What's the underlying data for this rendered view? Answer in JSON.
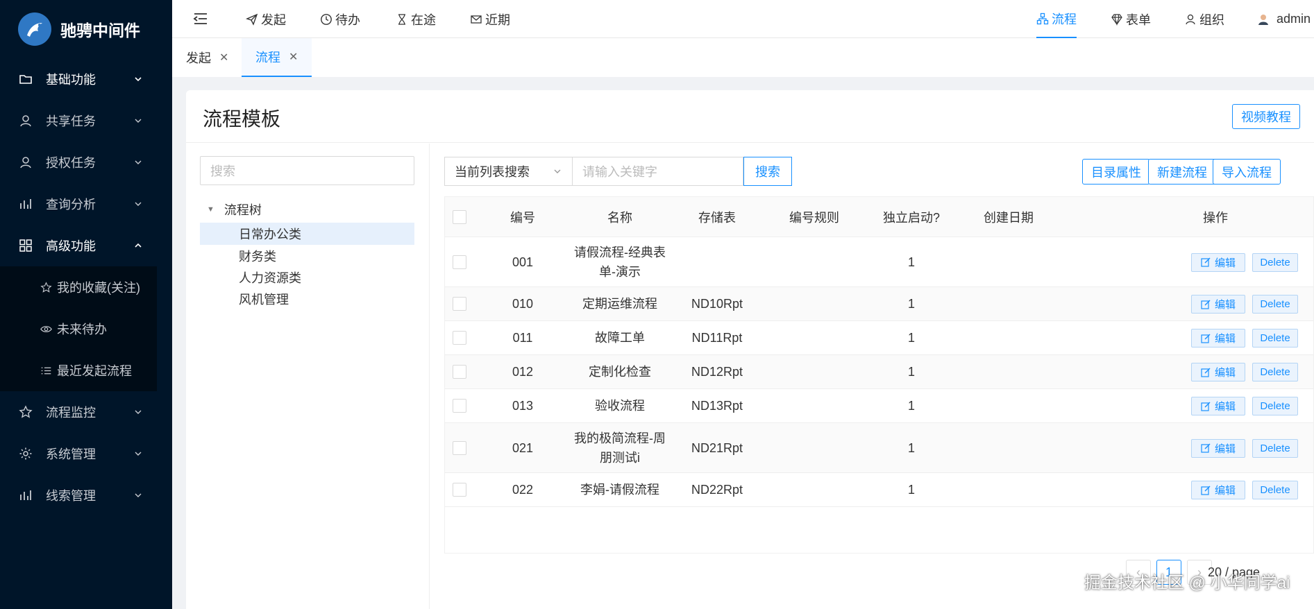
{
  "app": {
    "logo_text": "驰骋中间件"
  },
  "sidebar": {
    "items": [
      {
        "label": "基础功能",
        "icon": "folder-icon"
      },
      {
        "label": "共享任务",
        "icon": "user-share-icon"
      },
      {
        "label": "授权任务",
        "icon": "user-grant-icon"
      },
      {
        "label": "查询分析",
        "icon": "bar-chart-icon"
      },
      {
        "label": "高级功能",
        "icon": "grid-icon",
        "expanded": true
      }
    ],
    "sub_items": [
      {
        "label": "我的收藏(关注)",
        "icon": "star-icon"
      },
      {
        "label": "未来待办",
        "icon": "eye-icon"
      },
      {
        "label": "最近发起流程",
        "icon": "list-icon"
      }
    ],
    "items_after": [
      {
        "label": "流程监控",
        "icon": "star-icon"
      },
      {
        "label": "系统管理",
        "icon": "gear-icon"
      },
      {
        "label": "线索管理",
        "icon": "bar-chart-icon"
      }
    ]
  },
  "topnav": {
    "left": [
      {
        "label": "发起",
        "icon": "send-icon"
      },
      {
        "label": "待办",
        "icon": "clock-icon"
      },
      {
        "label": "在途",
        "icon": "hourglass-icon"
      },
      {
        "label": "近期",
        "icon": "mail-icon"
      }
    ],
    "right": [
      {
        "label": "流程",
        "icon": "flow-icon",
        "active": true
      },
      {
        "label": "表单",
        "icon": "diamond-icon"
      },
      {
        "label": "组织",
        "icon": "org-icon"
      },
      {
        "label": "admin",
        "icon": "avatar"
      }
    ]
  },
  "tabs": [
    {
      "label": "发起",
      "active": false
    },
    {
      "label": "流程",
      "active": true
    }
  ],
  "page": {
    "title": "流程模板",
    "video_button": "视频教程"
  },
  "tree": {
    "search_placeholder": "搜索",
    "root": "流程树",
    "nodes": [
      "日常办公类",
      "财务类",
      "人力资源类",
      "风机管理"
    ],
    "selected_index": 0
  },
  "search": {
    "mode": "当前列表搜索",
    "placeholder": "请输入关键字",
    "button": "搜索"
  },
  "actions": [
    "目录属性",
    "新建流程",
    "导入流程"
  ],
  "table": {
    "columns": [
      "编号",
      "名称",
      "存储表",
      "编号规则",
      "独立启动?",
      "创建日期",
      "操作"
    ],
    "edit_label": "编辑",
    "delete_label": "Delete",
    "rows": [
      {
        "no": "001",
        "name_line1": "请假流程-经典表",
        "name_line2": "单-演示",
        "table": "",
        "rule": "",
        "standalone": "1",
        "date": ""
      },
      {
        "no": "010",
        "name_line1": "定期运维流程",
        "name_line2": "",
        "table": "ND10Rpt",
        "rule": "",
        "standalone": "1",
        "date": ""
      },
      {
        "no": "011",
        "name_line1": "故障工单",
        "name_line2": "",
        "table": "ND11Rpt",
        "rule": "",
        "standalone": "1",
        "date": ""
      },
      {
        "no": "012",
        "name_line1": "定制化检查",
        "name_line2": "",
        "table": "ND12Rpt",
        "rule": "",
        "standalone": "1",
        "date": ""
      },
      {
        "no": "013",
        "name_line1": "验收流程",
        "name_line2": "",
        "table": "ND13Rpt",
        "rule": "",
        "standalone": "1",
        "date": ""
      },
      {
        "no": "021",
        "name_line1": "我的极简流程-周",
        "name_line2": "朋测试i",
        "table": "ND21Rpt",
        "rule": "",
        "standalone": "1",
        "date": ""
      },
      {
        "no": "022",
        "name_line1": "李娟-请假流程",
        "name_line2": "",
        "table": "ND22Rpt",
        "rule": "",
        "standalone": "1",
        "date": ""
      }
    ]
  },
  "pagination": {
    "current_page": "1",
    "page_size": "20 / page"
  },
  "watermark": "掘金技术社区 @ 小华同学ai",
  "colors": {
    "primary": "#1890ff",
    "sidebar": "#001529"
  }
}
